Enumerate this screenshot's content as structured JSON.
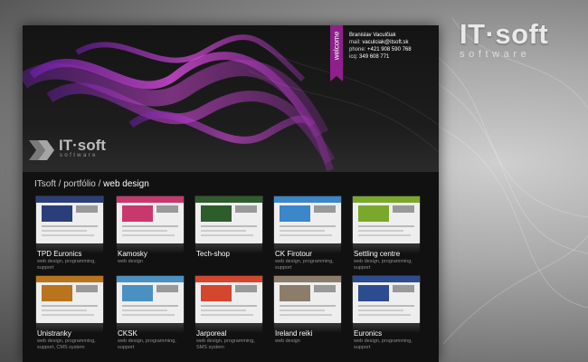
{
  "brand": {
    "name": "IT·soft",
    "tagline": "software"
  },
  "hero": {
    "logo_name": "IT·soft",
    "logo_tagline": "software",
    "ribbon_label": "welcome",
    "contact": {
      "name": "Branislav Vaculčiak",
      "mail_label": "mail:",
      "mail": "vaculciak@itsoft.sk",
      "phone_label": "phone:",
      "phone": "+421 908 590 768",
      "icq_label": "icq:",
      "icq": "349 608 771"
    }
  },
  "breadcrumb": {
    "part1": "ITsoft",
    "sep": " / ",
    "part2": "portfólio",
    "current": "web design"
  },
  "portfolio": [
    {
      "title": "TPD Euronics",
      "desc": "web design, programming, support",
      "color": "#2a3f7a"
    },
    {
      "title": "Kamosky",
      "desc": "web design",
      "color": "#c9386d"
    },
    {
      "title": "Tech-shop",
      "desc": "",
      "color": "#2d5d2b"
    },
    {
      "title": "CK Firotour",
      "desc": "web design, programming, support",
      "color": "#3b87c9"
    },
    {
      "title": "Settling centre",
      "desc": "web design, programming, support",
      "color": "#7aa82a"
    },
    {
      "title": "Unistranky",
      "desc": "web design, programming, support, CMS system",
      "color": "#b9741d"
    },
    {
      "title": "CKSK",
      "desc": "web design, programming, support",
      "color": "#4a91c2"
    },
    {
      "title": "Jarporeal",
      "desc": "web design, programming, SMS system",
      "color": "#d4462e"
    },
    {
      "title": "Ireland reiki",
      "desc": "web design",
      "color": "#8c7d6a"
    },
    {
      "title": "Euronics",
      "desc": "web design, programming, support",
      "color": "#2d4c8f"
    }
  ]
}
